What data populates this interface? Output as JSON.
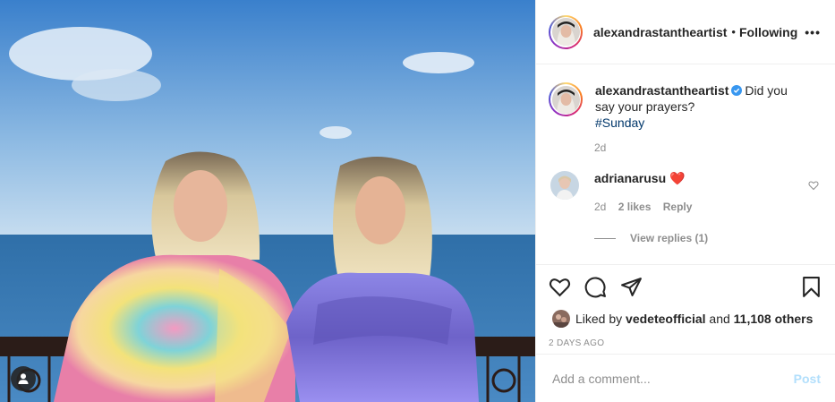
{
  "post": {
    "username": "alexandrastantheartist",
    "follow_separator": "•",
    "follow_label": "Following",
    "more_label": "•••"
  },
  "caption": {
    "username": "alexandrastantheartist",
    "text": "Did you say your prayers?",
    "hashtag": "#Sunday",
    "age": "2d"
  },
  "comment": {
    "username": "adrianarusu",
    "emoji": "❤️",
    "age": "2d",
    "likes": "2 likes",
    "reply_label": "Reply",
    "view_replies": "View replies (1)"
  },
  "likes": {
    "prefix": "Liked by",
    "user": "vedeteofficial",
    "and": "and",
    "others": "11,108 others"
  },
  "timestamp": "2 DAYS AGO",
  "add_comment": {
    "placeholder": "Add a comment...",
    "post_label": "Post"
  },
  "colors": {
    "link": "#00376b",
    "post_disabled": "#b2dffc",
    "muted": "#8e8e8e",
    "verified": "#3897f0"
  },
  "icons": [
    "heart-icon",
    "comment-icon",
    "share-icon",
    "save-icon",
    "more-icon",
    "verified-icon",
    "user-tag-icon"
  ]
}
